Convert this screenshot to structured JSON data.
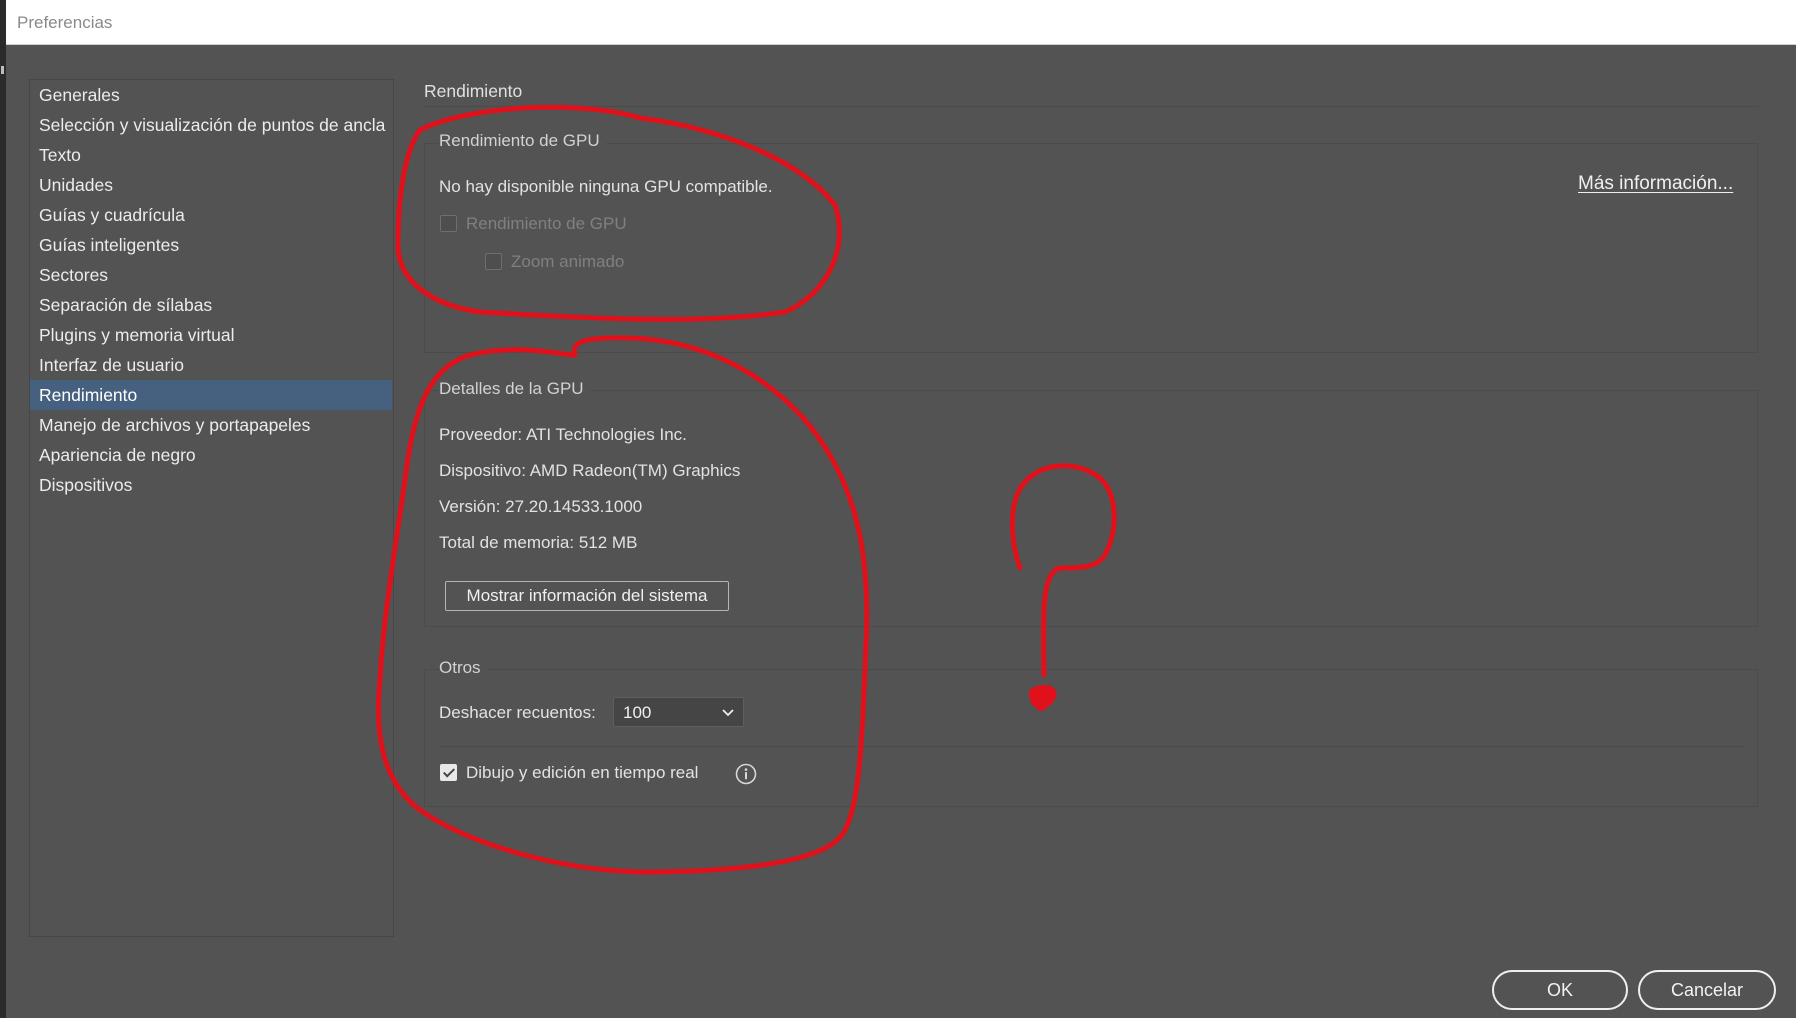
{
  "window": {
    "title": "Preferencias"
  },
  "sidebar": {
    "items": [
      {
        "label": "Generales"
      },
      {
        "label": "Selección y visualización de puntos de ancla"
      },
      {
        "label": "Texto"
      },
      {
        "label": "Unidades"
      },
      {
        "label": "Guías y cuadrícula"
      },
      {
        "label": "Guías inteligentes"
      },
      {
        "label": "Sectores"
      },
      {
        "label": "Separación de sílabas"
      },
      {
        "label": "Plugins y memoria virtual"
      },
      {
        "label": "Interfaz de usuario"
      },
      {
        "label": "Rendimiento",
        "selected": true
      },
      {
        "label": "Manejo de archivos y portapapeles"
      },
      {
        "label": "Apariencia de negro"
      },
      {
        "label": "Dispositivos"
      }
    ]
  },
  "panel": {
    "heading": "Rendimiento",
    "gpu_performance": {
      "title": "Rendimiento de GPU",
      "status": "No hay disponible ninguna GPU compatible.",
      "more_info_link": "Más información...",
      "gpu_checkbox": {
        "label": "Rendimiento de GPU",
        "checked": false,
        "disabled": true
      },
      "zoom_checkbox": {
        "label": "Zoom animado",
        "checked": false,
        "disabled": true
      }
    },
    "gpu_details": {
      "title": "Detalles de la GPU",
      "vendor": "Proveedor: ATI Technologies Inc.",
      "device": "Dispositivo: AMD Radeon(TM) Graphics",
      "version": "Versión: 27.20.14533.1000",
      "memory": "Total de memoria: 512 MB",
      "system_info_button": "Mostrar información del sistema"
    },
    "others": {
      "title": "Otros",
      "undo_label": "Deshacer recuentos:",
      "undo_value": "100",
      "live_drawing": {
        "label": "Dibujo y edición en tiempo real",
        "checked": true
      }
    }
  },
  "footer": {
    "ok": "OK",
    "cancel": "Cancelar"
  },
  "annotation": {
    "color": "#e0111b",
    "icon": "question-mark-drawn"
  }
}
